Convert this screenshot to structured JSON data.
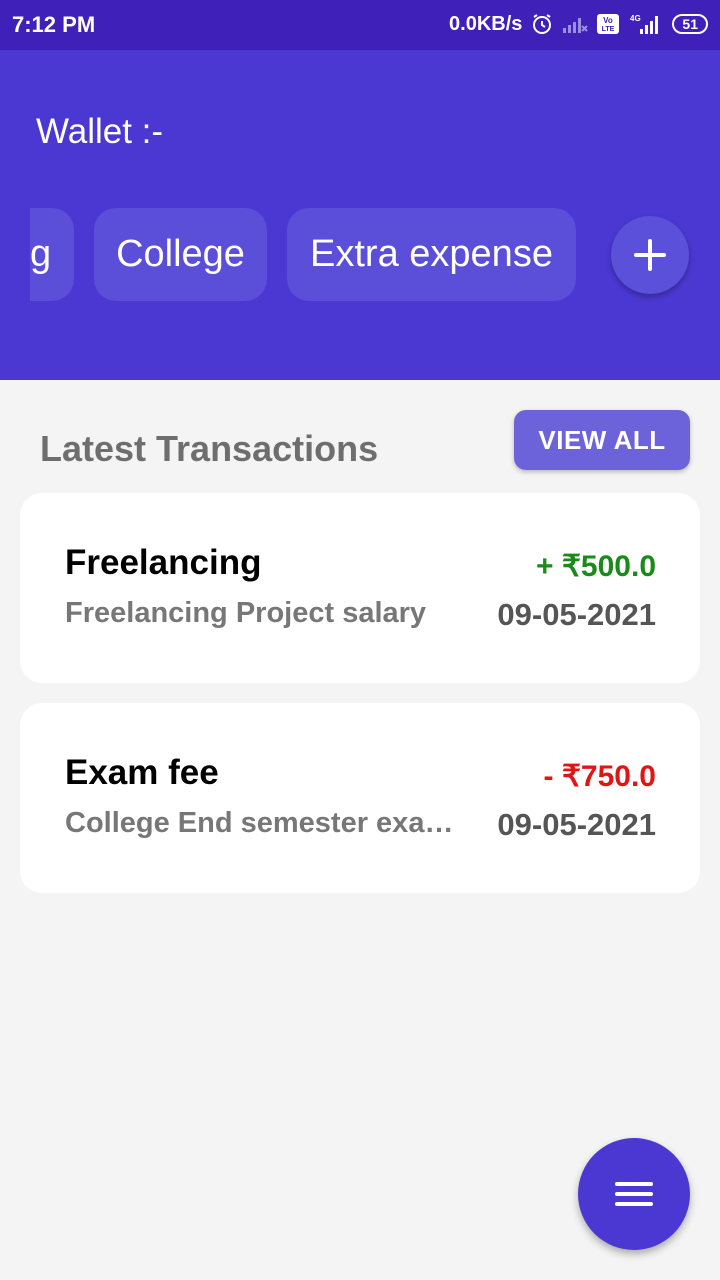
{
  "status_bar": {
    "time": "7:12 PM",
    "network_speed": "0.0KB/s",
    "volte": "Vo LTE",
    "network_type": "4G",
    "battery": "51",
    "icons": [
      "alarm-icon",
      "signal-empty-icon",
      "volte-icon",
      "signal-icon",
      "battery-icon"
    ]
  },
  "header": {
    "title": "Wallet :-",
    "wallets": [
      "g",
      "College",
      "Extra expense"
    ],
    "add_icon": "plus-icon"
  },
  "transactions_section": {
    "title": "Latest Transactions",
    "view_all_label": "VIEW ALL"
  },
  "transactions": [
    {
      "title": "Freelancing",
      "description": "Freelancing Project salary",
      "amount": "+ ₹500.0",
      "date": "09-05-2021",
      "type": "credit",
      "amount_color": "#1a8a1a"
    },
    {
      "title": "Exam fee",
      "description": "College End semester exam fee",
      "amount": "- ₹750.0",
      "date": "09-05-2021",
      "type": "debit",
      "amount_color": "#e01515"
    }
  ],
  "fab": {
    "icon": "menu-icon"
  },
  "colors": {
    "primary": "#4b38d2",
    "status_bar": "#3f20b8",
    "chip": "#5b4ed8",
    "button": "#6c63da"
  }
}
